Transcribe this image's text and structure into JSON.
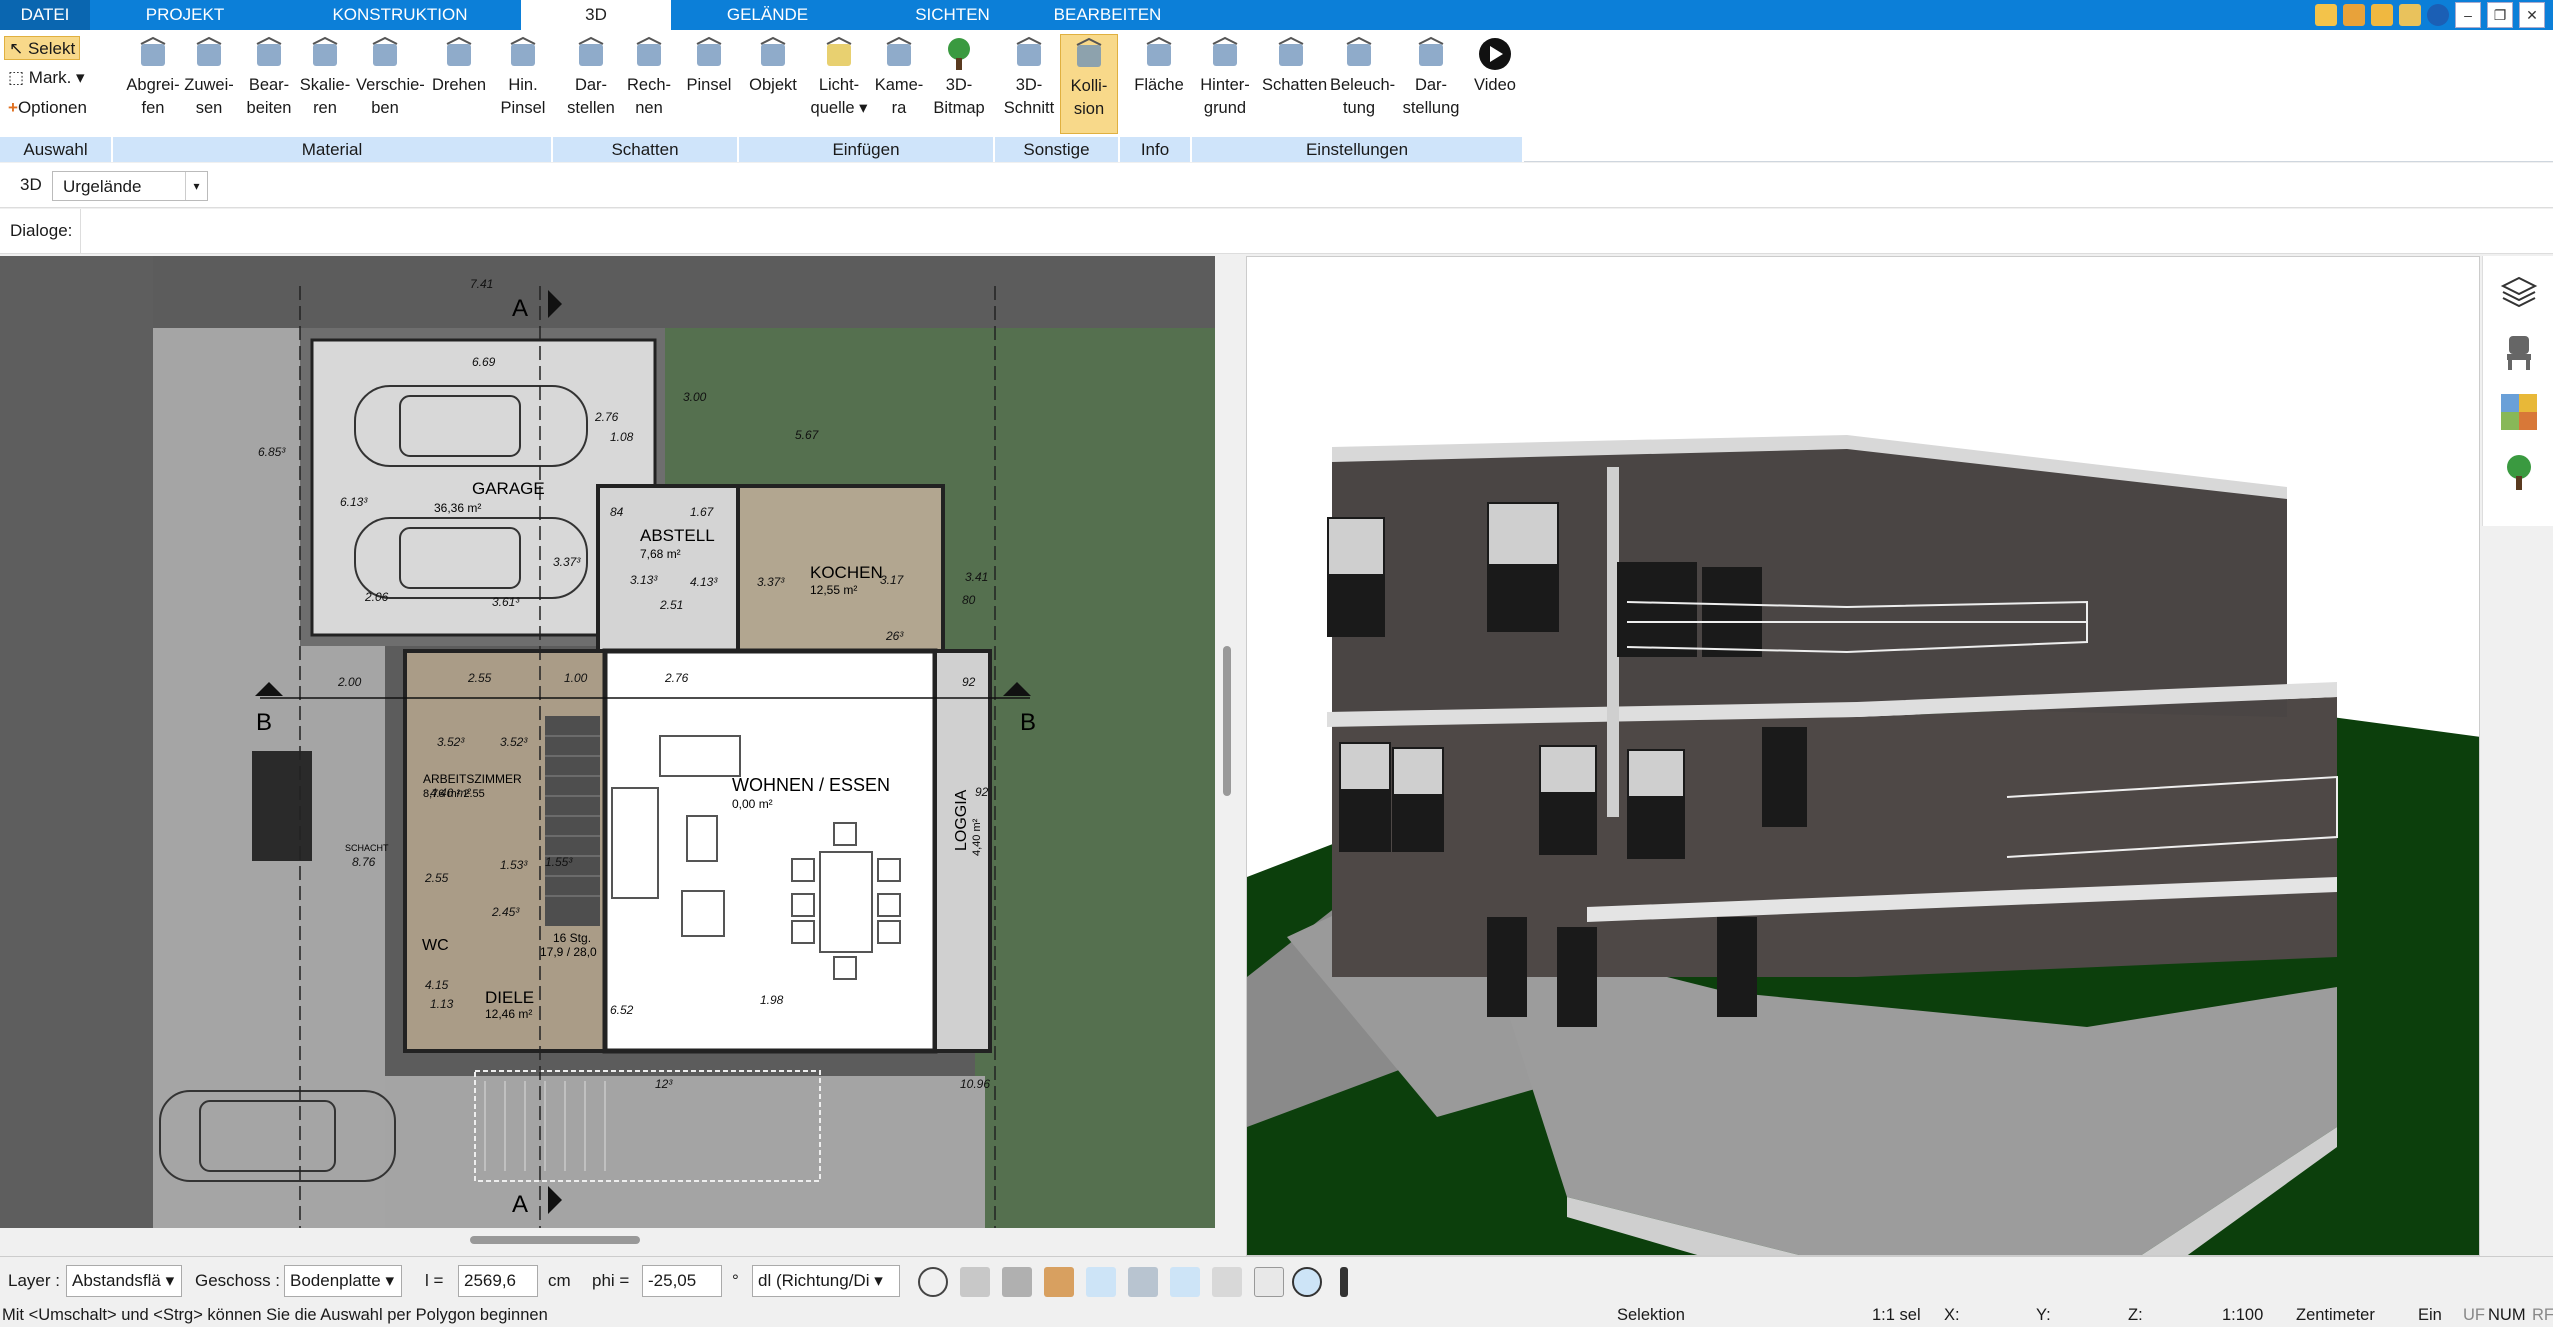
{
  "tabs": [
    "DATEI",
    "PROJEKT",
    "KONSTRUKTION",
    "3D",
    "GELÄNDE",
    "SICHTEN",
    "BEARBEITEN"
  ],
  "auswahl": {
    "select": "Selekt",
    "mark": "Mark.",
    "options": "Optionen",
    "label": "Auswahl"
  },
  "groups": {
    "material": "Material",
    "schatten": "Schatten",
    "einfuegen": "Einfügen",
    "sonstige": "Sonstige",
    "info": "Info",
    "einstellungen": "Einstellungen"
  },
  "buttons": [
    {
      "l1": "Abgrei-",
      "l2": "fen"
    },
    {
      "l1": "Zuwei-",
      "l2": "sen"
    },
    {
      "l1": "Bear-",
      "l2": "beiten"
    },
    {
      "l1": "Skalie-",
      "l2": "ren"
    },
    {
      "l1": "Verschie-",
      "l2": "ben"
    },
    {
      "l1": "Drehen",
      "l2": ""
    },
    {
      "l1": "Hin.",
      "l2": "Pinsel"
    },
    {
      "l1": "Dar-",
      "l2": "stellen"
    },
    {
      "l1": "Rech-",
      "l2": "nen"
    },
    {
      "l1": "Pinsel",
      "l2": ""
    },
    {
      "l1": "Objekt",
      "l2": ""
    },
    {
      "l1": "Licht-",
      "l2": "quelle ▾"
    },
    {
      "l1": "Kame-",
      "l2": "ra"
    },
    {
      "l1": "3D-",
      "l2": "Bitmap"
    },
    {
      "l1": "3D-",
      "l2": "Schnitt"
    },
    {
      "l1": "Kolli-",
      "l2": "sion"
    },
    {
      "l1": "Fläche",
      "l2": ""
    },
    {
      "l1": "Hinter-",
      "l2": "grund"
    },
    {
      "l1": "Schatten",
      "l2": ""
    },
    {
      "l1": "Beleuch-",
      "l2": "tung"
    },
    {
      "l1": "Dar-",
      "l2": "stellung"
    },
    {
      "l1": "Video",
      "l2": ""
    }
  ],
  "bar3d": {
    "label": "3D",
    "select": "Urgelände"
  },
  "dialoge": {
    "label": "Dialoge:"
  },
  "plan": {
    "dims": [
      "7.41",
      "6.69",
      "2.76",
      "1.08",
      "3.00",
      "5.67",
      "6.85³",
      "6.13³",
      "3.37³",
      "2.06",
      "3.61³",
      "1.67",
      "84",
      "3.13³",
      "4.13³",
      "3.37³",
      "3.17",
      "2.51",
      "3.41",
      "80",
      "26³",
      "2.55",
      "1.00",
      "2.76",
      "2.00",
      "92",
      "3.52³",
      "3.52³",
      "2.55",
      "1.53³",
      "2.45³",
      "1.55³",
      "8.76",
      "4.15",
      "1.13",
      "1.98",
      "6.52",
      "12³",
      "10.96",
      "92",
      "4.40 m²",
      "8.76 m²"
    ],
    "rooms": {
      "garage": "GARAGE",
      "garage_area": "36,36 m²",
      "abstell": "ABSTELL",
      "abstell_area": "7,68 m²",
      "kochen": "KOCHEN",
      "kochen_area": "12,55 m²",
      "wohnen": "WOHNEN / ESSEN",
      "wohnen_area": "0,00 m²",
      "arbeit": "ARBEITSZIMMER",
      "arbeit_area": "8,76 m²  2.55",
      "wc": "WC",
      "diele": "DIELE",
      "diele_area": "12,46 m²",
      "loggia": "LOGGIA",
      "stairs": "16 Stg.",
      "stairs2": "17,9 / 28,0",
      "schacht": "SCHACHT",
      "b_left": "B",
      "b_right": "B",
      "a_top": "A",
      "a_bottom": "A",
      "loggia_area": "4,40 m²"
    }
  },
  "bottom": {
    "layer_label": "Layer :",
    "layer_value": "Abstandsflä",
    "geschoss_label": "Geschoss :",
    "geschoss_value": "Bodenplatte",
    "l_label": "l =",
    "l_value": "2569,6",
    "l_unit": "cm",
    "phi_label": "phi =",
    "phi_value": "-25,05",
    "phi_unit": "°",
    "dl_value": "dl (Richtung/Di"
  },
  "status": {
    "hint": "Mit <Umschalt> und <Strg> können Sie die Auswahl per Polygon beginnen",
    "mode": "Selektion",
    "sel": "1:1 sel",
    "x": "X:",
    "y": "Y:",
    "z": "Z:",
    "scale": "1:100",
    "unit": "Zentimeter",
    "ein": "Ein",
    "uf": "UF",
    "num": "NUM",
    "rf": "RF"
  },
  "colors": {
    "accent": "#0c7fd8",
    "ribbon_group": "#cfe4fa",
    "active_button": "#f8d98a",
    "grass": "#55704f",
    "floor": "#ffffff"
  }
}
